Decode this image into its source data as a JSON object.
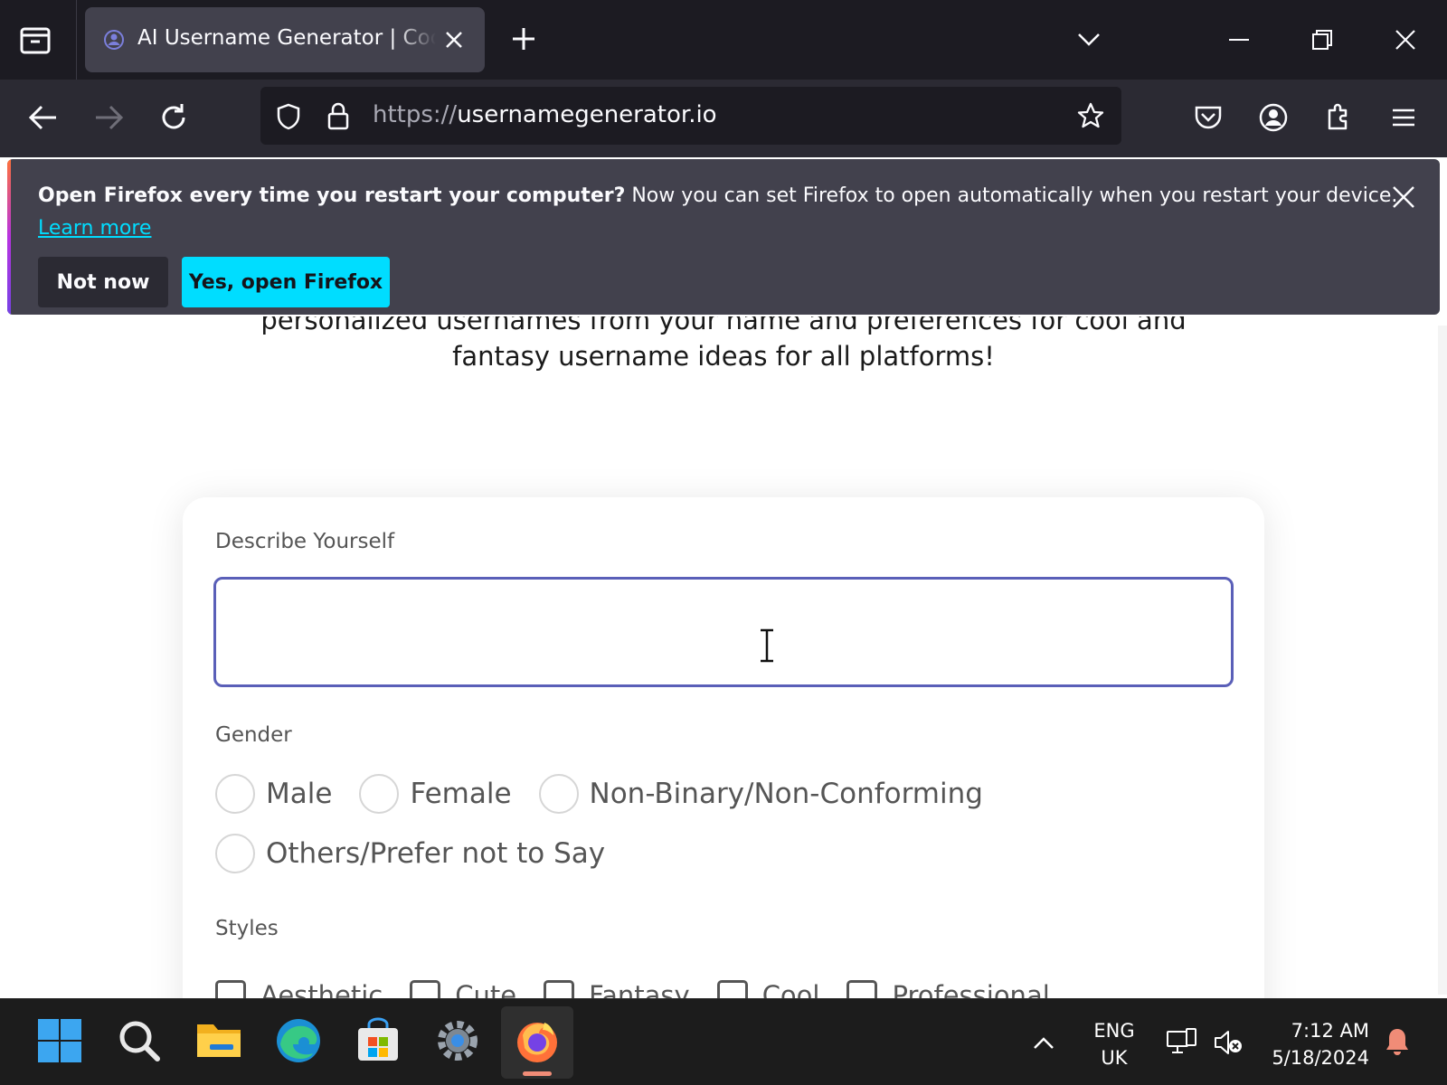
{
  "browser": {
    "tab": {
      "title": "AI Username Generator | Cool Usernames"
    },
    "url": {
      "scheme": "https://",
      "host": "usernamegenerator.io"
    }
  },
  "notification": {
    "bold_text": "Open Firefox every time you restart your computer?",
    "text": " Now you can set Firefox to open automatically when you restart your device.",
    "learn_more": "Learn more",
    "not_now": "Not now",
    "yes_open": "Yes, open Firefox",
    "accent": "#00ddff"
  },
  "page": {
    "intro_line1": "personalized usernames from your name and preferences for cool and",
    "intro_line2": "fantasy username ideas for all platforms!",
    "form": {
      "describe_label": "Describe Yourself",
      "describe_value": "",
      "gender_label": "Gender",
      "gender_options": [
        "Male",
        "Female",
        "Non-Binary/Non-Conforming",
        "Others/Prefer not to Say"
      ],
      "styles_label": "Styles",
      "style_options": [
        "Aesthetic",
        "Cute",
        "Fantasy",
        "Cool",
        "Professional"
      ],
      "input_border_color": "#5a5fb8"
    }
  },
  "taskbar": {
    "apps": [
      "windows-start",
      "search",
      "file-explorer",
      "edge",
      "microsoft-store",
      "settings",
      "firefox"
    ],
    "lang_line1": "ENG",
    "lang_line2": "UK",
    "time": "7:12 AM",
    "date": "5/18/2024"
  }
}
